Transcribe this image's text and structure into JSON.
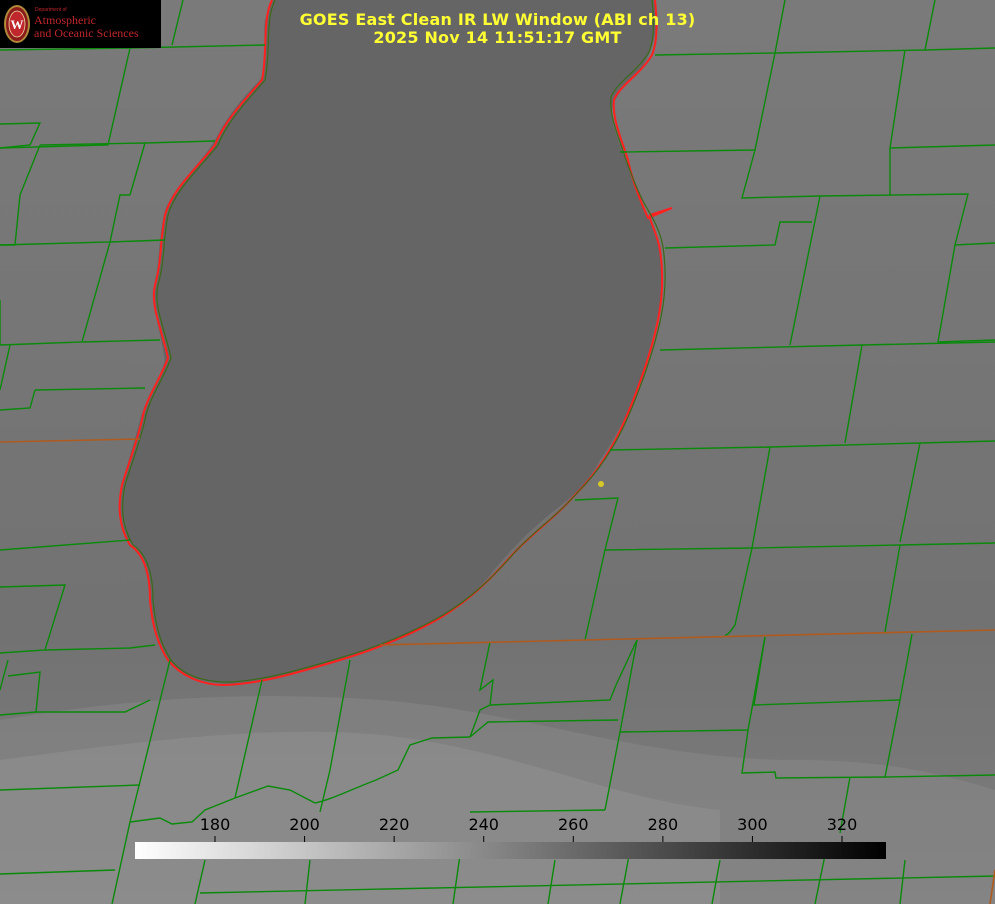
{
  "logo": {
    "department": "Department of",
    "line1": "Atmospheric",
    "line2": "and Oceanic Sciences",
    "seal_letter": "W"
  },
  "title": {
    "line1": "GOES East Clean IR LW Window (ABI ch 13)",
    "line2": "2025 Nov 14 11:51:17 GMT"
  },
  "colorbar": {
    "ticks": [
      "180",
      "200",
      "220",
      "240",
      "260",
      "280",
      "300",
      "320"
    ],
    "colormap": "grayscale-inverted",
    "gradient_start": "#ffffff",
    "gradient_end": "#000000"
  },
  "colors": {
    "county_lines": "#0a8a0a",
    "state_lines": "#b05a1e",
    "lake_outline": "#ff2020",
    "title_text": "#ffff33",
    "marker": "#d8c828"
  }
}
